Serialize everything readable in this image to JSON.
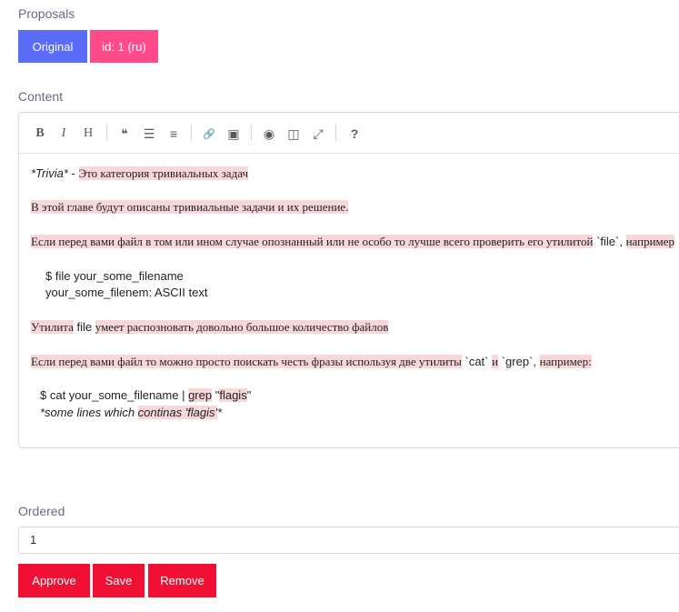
{
  "proposals": {
    "label": "Proposals",
    "buttons": [
      {
        "label": "Original",
        "color": "#5b6cf9"
      },
      {
        "label": "id: 1 (ru)",
        "color": "#ff4b8a"
      }
    ]
  },
  "content": {
    "label": "Content",
    "toolbar": [
      {
        "name": "bold-icon",
        "glyph": "B"
      },
      {
        "name": "italic-icon",
        "glyph": "I"
      },
      {
        "name": "heading-icon",
        "glyph": "H"
      },
      {
        "name": "quote-icon",
        "glyph": "❝"
      },
      {
        "name": "unordered-list-icon",
        "glyph": "☰"
      },
      {
        "name": "ordered-list-icon",
        "glyph": "≡"
      },
      {
        "name": "link-icon",
        "glyph": "🔗"
      },
      {
        "name": "image-icon",
        "glyph": "▣"
      },
      {
        "name": "preview-icon",
        "glyph": "◉"
      },
      {
        "name": "side-by-side-icon",
        "glyph": "◫"
      },
      {
        "name": "fullscreen-icon",
        "glyph": "⤢"
      },
      {
        "name": "help-icon",
        "glyph": "?"
      }
    ],
    "lines": {
      "l1_a": "*Trivia*",
      "l1_b": " - ",
      "l1_c": "Это категория тривиальных задач",
      "l2": "В этой главе будут описаны тривиальные задачи и их решение.",
      "l3_a": "Если перед вами файл в том или ином случае опознанный или не особо то лучше всего проверить его утилитой",
      "l3_b": " `file`, ",
      "l3_c": " например",
      "l4": "$ file your_some_filename",
      "l5": "your_some_filenem: ASCII text",
      "l6_a": "Утилита",
      "l6_b": " file ",
      "l6_c": "умеет распозновать довольно большое количество файлов",
      "l7_a": "Если перед вами файл то можно просто поискать честь фразы используя две утилиты",
      "l7_b": " `cat` ",
      "l7_c": "и",
      "l7_d": " `grep`, ",
      "l7_e": "например:",
      "l8_a": "$ cat your_some_filename | ",
      "l8_b": "grep",
      "l8_c": " \"",
      "l8_d": "flagis",
      "l8_e": "\"",
      "l9_a": "*some lines which ",
      "l9_b": "continas 'flagis'",
      "l9_c": "*"
    }
  },
  "ordered": {
    "label": "Ordered",
    "value": "1"
  },
  "actions": {
    "approve": "Approve",
    "save": "Save",
    "remove": "Remove"
  }
}
